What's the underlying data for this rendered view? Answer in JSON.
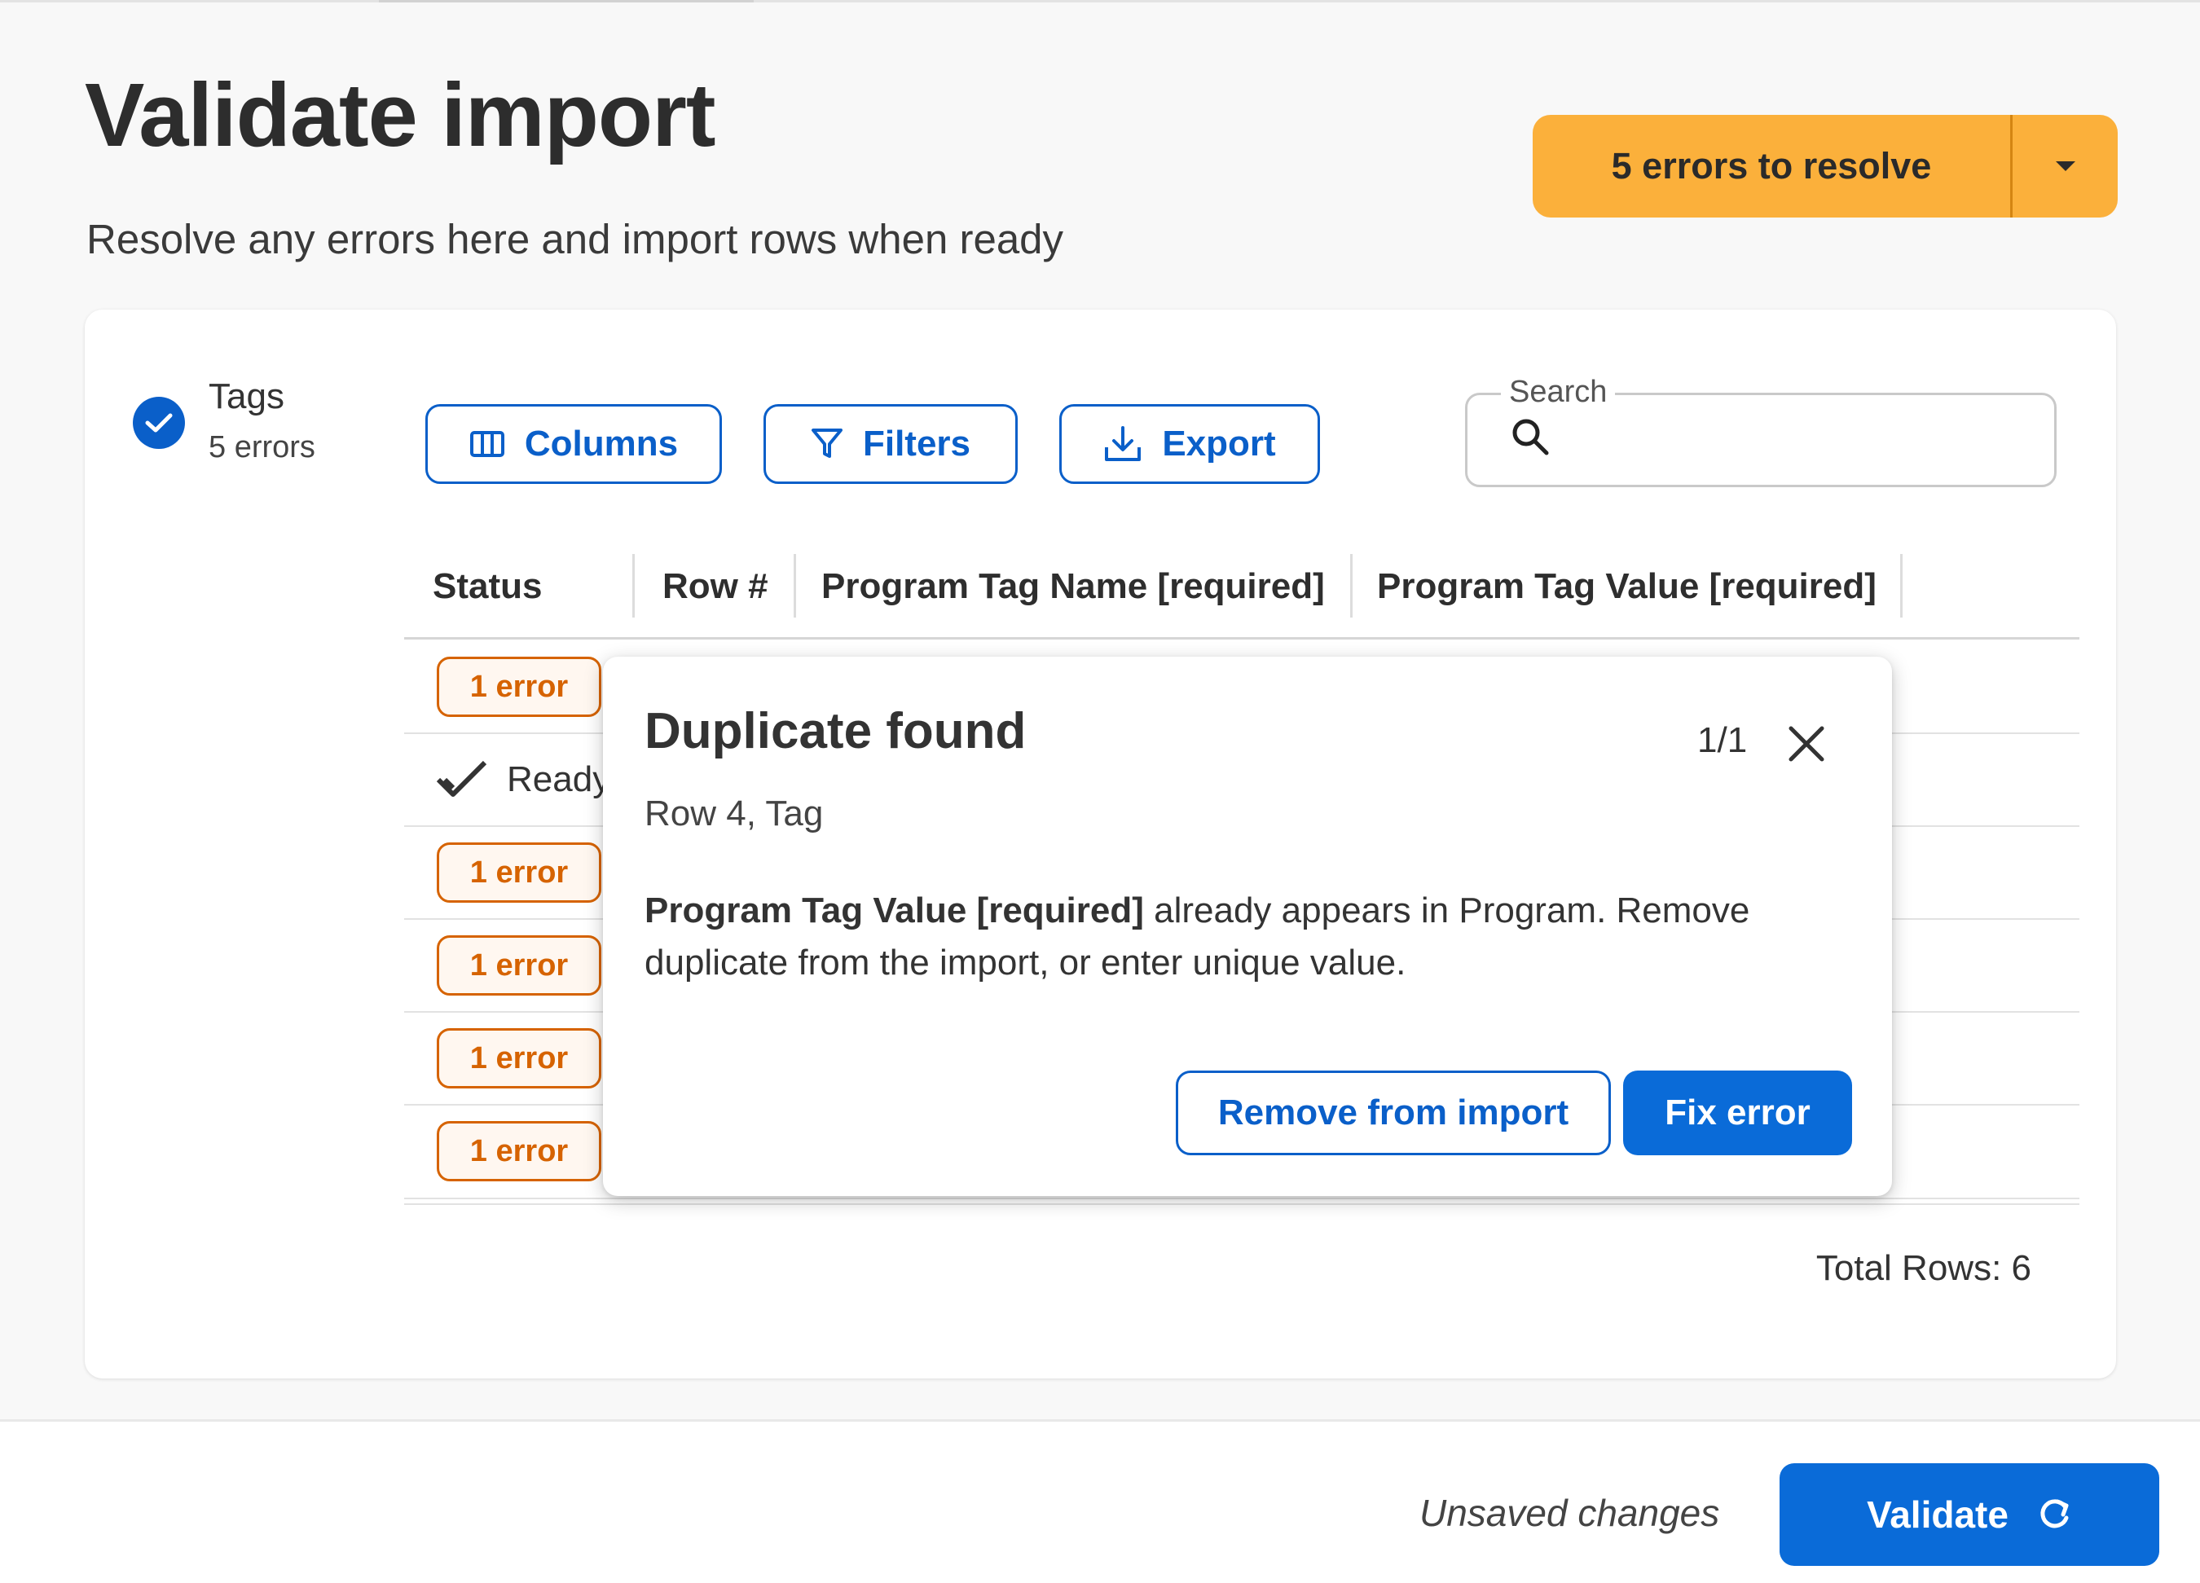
{
  "header": {
    "title": "Validate import",
    "subtitle": "Resolve any errors here and import rows when ready",
    "errors_button": {
      "label": "5 errors to resolve",
      "color": "#fbb03b"
    }
  },
  "sidebar": {
    "tag_name": "Tags",
    "tag_errors": "5 errors"
  },
  "toolbar": {
    "columns_label": "Columns",
    "filters_label": "Filters",
    "export_label": "Export",
    "search_label": "Search",
    "search_value": ""
  },
  "table": {
    "headers": [
      "Status",
      "Row #",
      "Program Tag Name [required]",
      "Program Tag Value [required]"
    ],
    "rows": [
      {
        "status": "1 error"
      },
      {
        "status": "Ready"
      },
      {
        "status": "1 error"
      },
      {
        "status": "1 error"
      },
      {
        "status": "1 error"
      },
      {
        "status": "1 error"
      }
    ],
    "total_rows": "Total Rows: 6"
  },
  "popover": {
    "title": "Duplicate found",
    "counter": "1/1",
    "location": "Row 4, Tag",
    "message_field": "Program Tag Value [required]",
    "message_rest": " already appears in Program. Remove duplicate from the import, or enter unique value.",
    "remove_label": "Remove from import",
    "fix_label": "Fix error"
  },
  "footer": {
    "status": "Unsaved changes",
    "validate_label": "Validate"
  },
  "colors": {
    "primary": "#0a6bd8",
    "warning": "#fbb03b",
    "error": "#d66300"
  }
}
